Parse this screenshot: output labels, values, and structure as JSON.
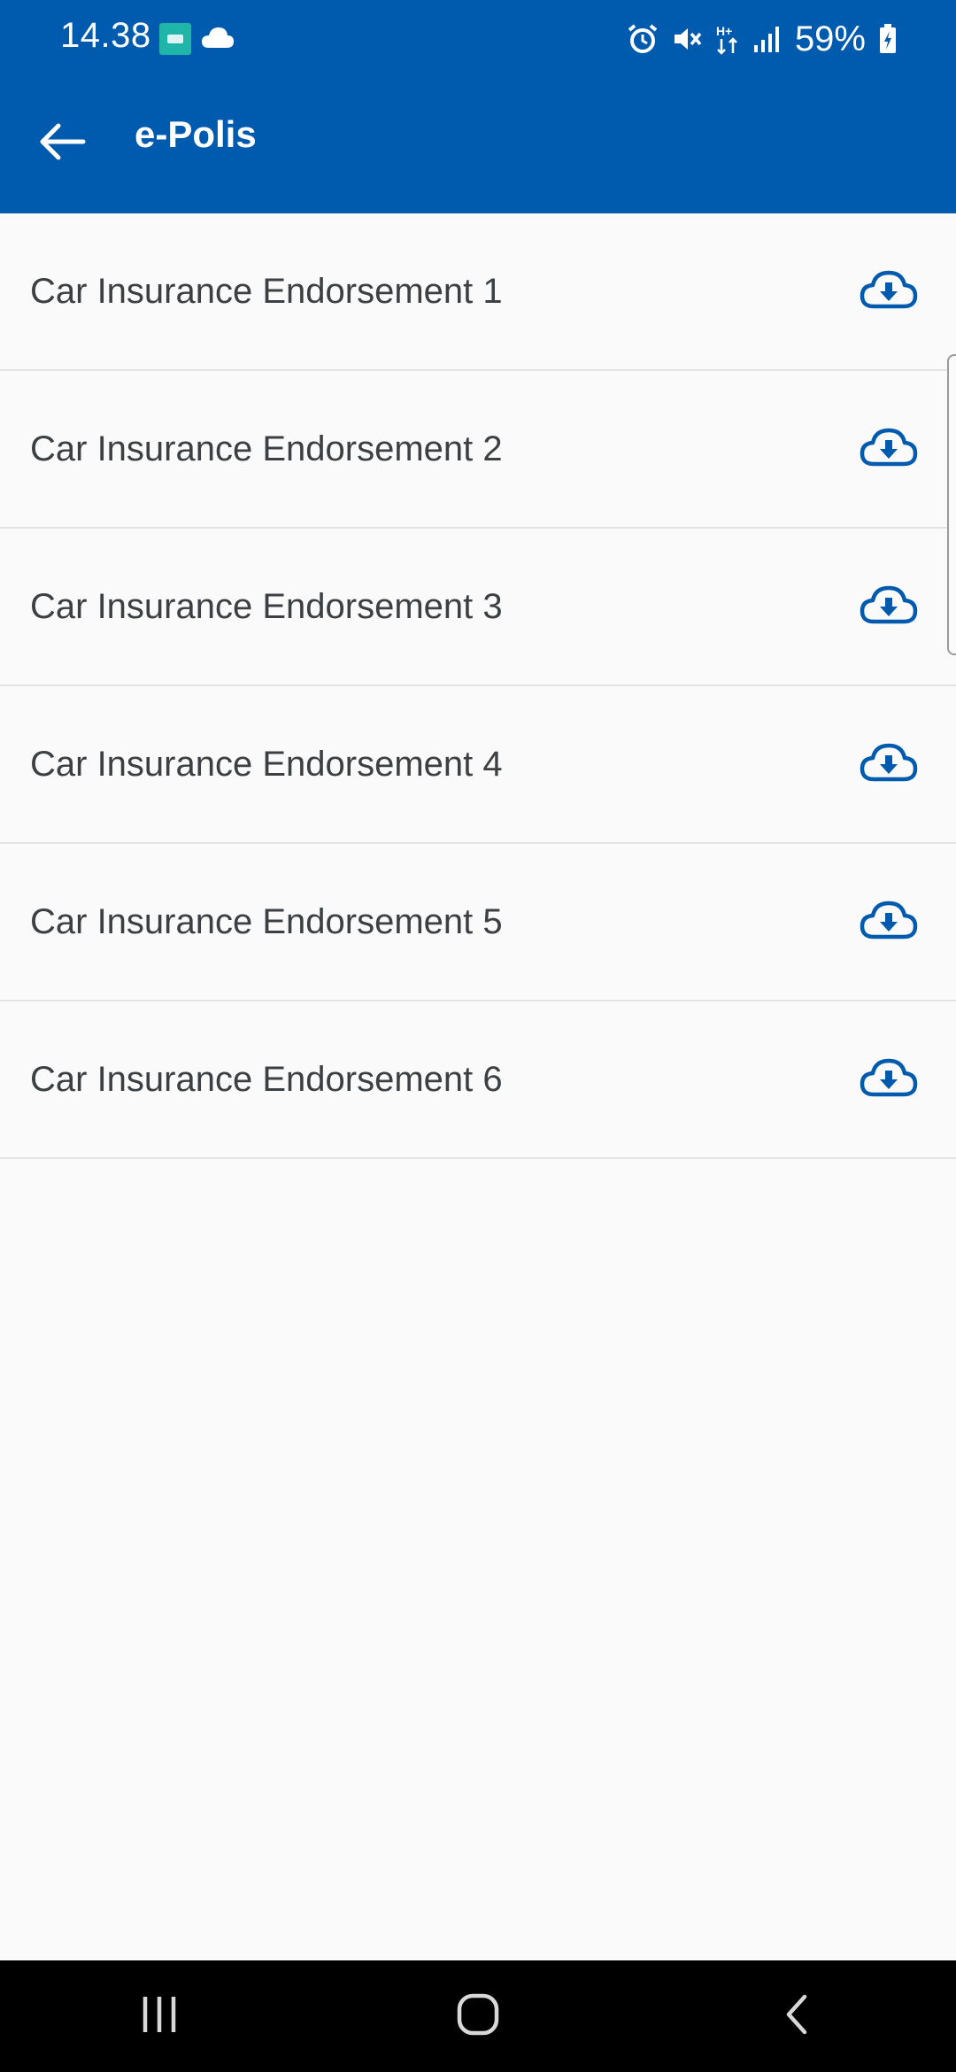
{
  "status_bar": {
    "time": "14.38",
    "battery_percent": "59%",
    "icons": [
      "app-notification-icon",
      "cloud-icon",
      "alarm-icon",
      "mute-icon",
      "data-transfer-icon",
      "signal-icon",
      "battery-icon"
    ]
  },
  "app_bar": {
    "title": "e-Polis",
    "back_icon": "arrow-left-icon"
  },
  "documents": [
    {
      "label": "Car Insurance Endorsement 1",
      "icon": "cloud-download-icon"
    },
    {
      "label": "Car Insurance Endorsement 2",
      "icon": "cloud-download-icon"
    },
    {
      "label": "Car Insurance Endorsement 3",
      "icon": "cloud-download-icon"
    },
    {
      "label": "Car Insurance Endorsement 4",
      "icon": "cloud-download-icon"
    },
    {
      "label": "Car Insurance Endorsement 5",
      "icon": "cloud-download-icon"
    },
    {
      "label": "Car Insurance Endorsement 6",
      "icon": "cloud-download-icon"
    }
  ],
  "nav_bar": {
    "buttons": [
      "recent-apps-icon",
      "home-icon",
      "back-icon"
    ]
  },
  "colors": {
    "primary": "#005aad",
    "text": "#3c4043",
    "background": "#fafafa",
    "divider": "#e3e3e3"
  }
}
